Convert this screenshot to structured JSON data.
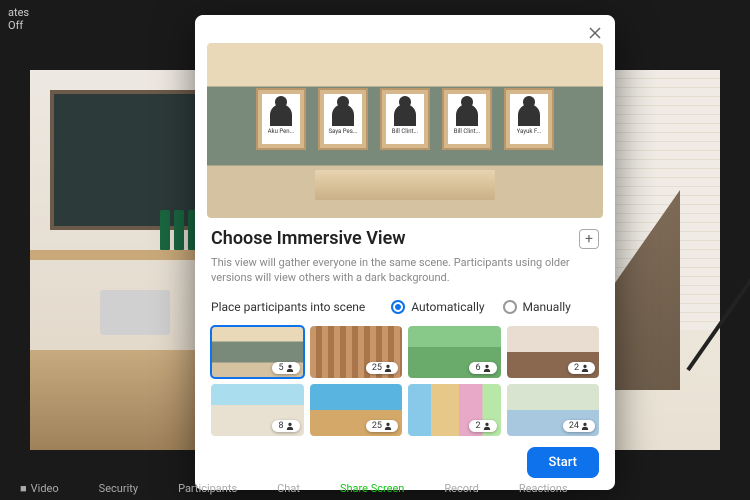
{
  "topbar": {
    "label_left": "ates",
    "label_off": "Off"
  },
  "modal": {
    "title": "Choose Immersive View",
    "description": "This view will gather everyone in the same scene. Participants using older versions will view others with a dark background.",
    "place_label": "Place participants into scene",
    "radio_auto": "Automatically",
    "radio_manual": "Manually",
    "radio_selected": "auto",
    "start_label": "Start",
    "add_label": "+"
  },
  "participants": [
    {
      "name": "Aku Pen..."
    },
    {
      "name": "Saya Pes..."
    },
    {
      "name": "Bill Clint..."
    },
    {
      "name": "Bill Clint..."
    },
    {
      "name": "Yayuk F..."
    }
  ],
  "scenes": [
    {
      "count": "5",
      "selected": true,
      "cls": "sc1"
    },
    {
      "count": "25",
      "selected": false,
      "cls": "sc2"
    },
    {
      "count": "6",
      "selected": false,
      "cls": "sc3"
    },
    {
      "count": "2",
      "selected": false,
      "cls": "sc4"
    },
    {
      "count": "8",
      "selected": false,
      "cls": "sc5"
    },
    {
      "count": "25",
      "selected": false,
      "cls": "sc6"
    },
    {
      "count": "2",
      "selected": false,
      "cls": "sc7"
    },
    {
      "count": "24",
      "selected": false,
      "cls": "sc8"
    }
  ],
  "toolbar": {
    "video": "Video",
    "security": "Security",
    "participants": "Participants",
    "chat": "Chat",
    "share": "Share Screen",
    "record": "Record",
    "reactions": "Reactions"
  }
}
